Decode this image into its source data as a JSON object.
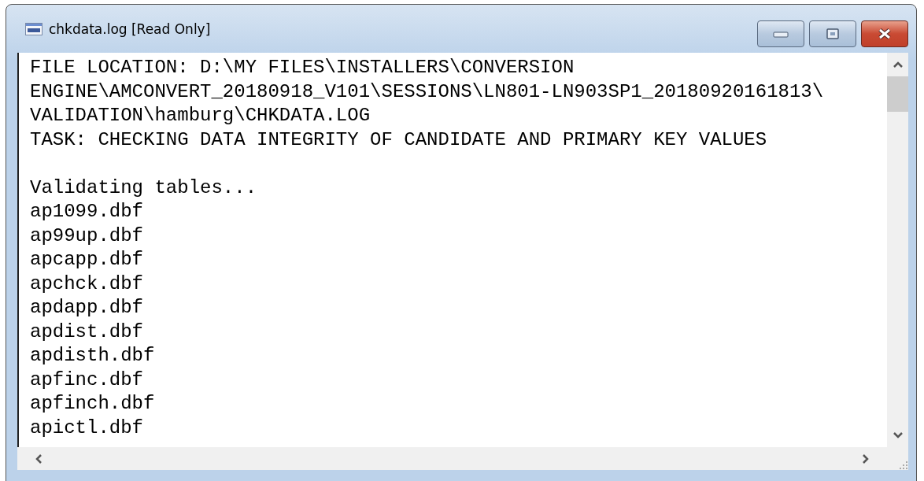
{
  "window": {
    "title": "chkdata.log [Read Only]"
  },
  "header_lines": [
    "FILE LOCATION: D:\\MY FILES\\INSTALLERS\\CONVERSION",
    "ENGINE\\AMCONVERT_20180918_V101\\SESSIONS\\LN801-LN903SP1_20180920161813\\",
    "VALIDATION\\hamburg\\CHKDATA.LOG",
    "TASK: CHECKING DATA INTEGRITY OF CANDIDATE AND PRIMARY KEY VALUES"
  ],
  "body_lines": [
    "Validating tables...",
    "ap1099.dbf",
    "ap99up.dbf",
    "apcapp.dbf",
    "apchck.dbf",
    "apdapp.dbf",
    "apdist.dbf",
    "apdisth.dbf",
    "apfinc.dbf",
    "apfinch.dbf",
    "apictl.dbf"
  ]
}
